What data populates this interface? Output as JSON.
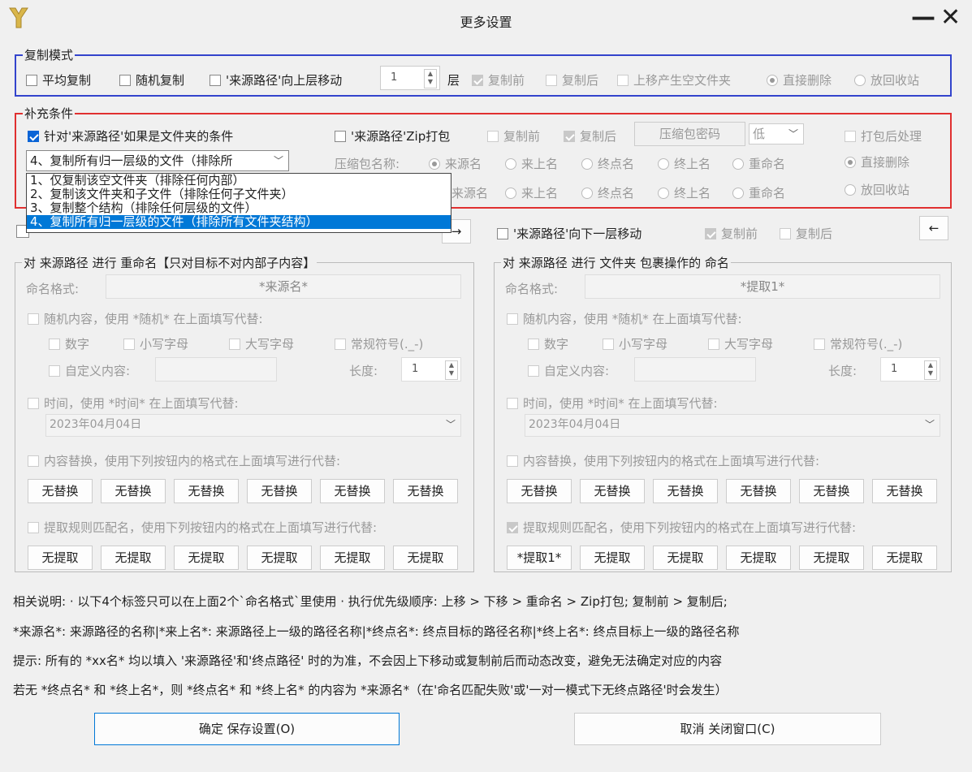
{
  "window": {
    "title": "更多设置",
    "minimize": "—",
    "close": "✕"
  },
  "copy_mode": {
    "legend": "复制模式",
    "avg": "平均复制",
    "random": "随机复制",
    "move_up": "'来源路径'向上层移动",
    "levels": "1",
    "level_unit": "层",
    "before": "复制前",
    "after": "复制后",
    "empty_folder": "上移产生空文件夹",
    "delete": "直接删除",
    "recycle": "放回收站"
  },
  "extra": {
    "legend": "补充条件",
    "folder_cond": "针对'来源路径'如果是文件夹的条件",
    "zip": "'来源路径'Zip打包",
    "before": "复制前",
    "after": "复制后",
    "zip_pwd": "压缩包密码",
    "level": "低",
    "post": "打包后处理",
    "zip_name": "压缩包名称:",
    "names": [
      "来源名",
      "来上名",
      "终点名",
      "终上名",
      "重命名"
    ],
    "delete": "直接删除",
    "recycle": "放回收站",
    "combo_value": "4、复制所有归一层级的文件（排除所",
    "options": [
      "1、仅复制该空文件夹（排除任何内部）",
      "2、复制该文件夹和子文件（排除任何子文件夹）",
      "3、复制整个结构（排除任何层级的文件）",
      "4、复制所有归一层级的文件（排除所有文件夹结构）"
    ]
  },
  "move_down": {
    "label": "'来源路径'向下一层移动",
    "before": "复制前",
    "after": "复制后"
  },
  "left": {
    "legend": "对 来源路径 进行 重命名【只对目标不对内部子内容】",
    "format_label": "命名格式:",
    "format_value": "*来源名*",
    "random": "随机内容，使用 *随机* 在上面填写代替:",
    "digits": "数字",
    "lower": "小写字母",
    "upper": "大写字母",
    "symbols": "常规符号(._-)",
    "custom": "自定义内容:",
    "length": "长度:",
    "length_value": "1",
    "time": "时间，使用 *时间* 在上面填写代替:",
    "date": "2023年04月04日",
    "replace": "内容替换，使用下列按钮内的格式在上面填写进行代替:",
    "replace_btns": [
      "无替换",
      "无替换",
      "无替换",
      "无替换",
      "无替换",
      "无替换"
    ],
    "extract": "提取规则匹配名，使用下列按钮内的格式在上面填写进行代替:",
    "extract_btns": [
      "无提取",
      "无提取",
      "无提取",
      "无提取",
      "无提取",
      "无提取"
    ]
  },
  "right": {
    "legend": "对 来源路径 进行 文件夹 包裹操作的 命名",
    "format_label": "命名格式:",
    "format_value": "*提取1*",
    "random": "随机内容，使用 *随机* 在上面填写代替:",
    "digits": "数字",
    "lower": "小写字母",
    "upper": "大写字母",
    "symbols": "常规符号(._-)",
    "custom": "自定义内容:",
    "length": "长度:",
    "length_value": "1",
    "time": "时间，使用 *时间* 在上面填写代替:",
    "date": "2023年04月04日",
    "replace": "内容替换，使用下列按钮内的格式在上面填写进行代替:",
    "replace_btns": [
      "无替换",
      "无替换",
      "无替换",
      "无替换",
      "无替换",
      "无替换"
    ],
    "extract": "提取规则匹配名，使用下列按钮内的格式在上面填写进行代替:",
    "extract_btns": [
      "*提取1*",
      "无提取",
      "无提取",
      "无提取",
      "无提取",
      "无提取"
    ]
  },
  "notes": [
    "相关说明: · 以下4个标签只可以在上面2个`命名格式`里使用 · 执行优先级顺序: 上移 > 下移 > 重命名 > Zip打包; 复制前 > 复制后;",
    "*来源名*: 来源路径的名称|*来上名*: 来源路径上一级的路径名称|*终点名*: 终点目标的路径名称|*终上名*: 终点目标上一级的路径名称",
    "提示: 所有的 *xx名* 均以填入 '来源路径'和'终点路径' 时的为准，不会因上下移动或复制前后而动态改变，避免无法确定对应的内容",
    "若无 *终点名* 和 *终上名*，则 *终点名* 和 *终上名* 的内容为 *来源名*（在'命名匹配失败'或'一对一模式下无终点路径'时会发生）"
  ],
  "footer": {
    "ok": "确定 保存设置(O)",
    "cancel": "取消 关闭窗口(C)"
  },
  "arrow": "←",
  "colors": {
    "copy_mode_border": "#3344cc",
    "extra_border": "#e03030",
    "accent": "#0078d7"
  }
}
